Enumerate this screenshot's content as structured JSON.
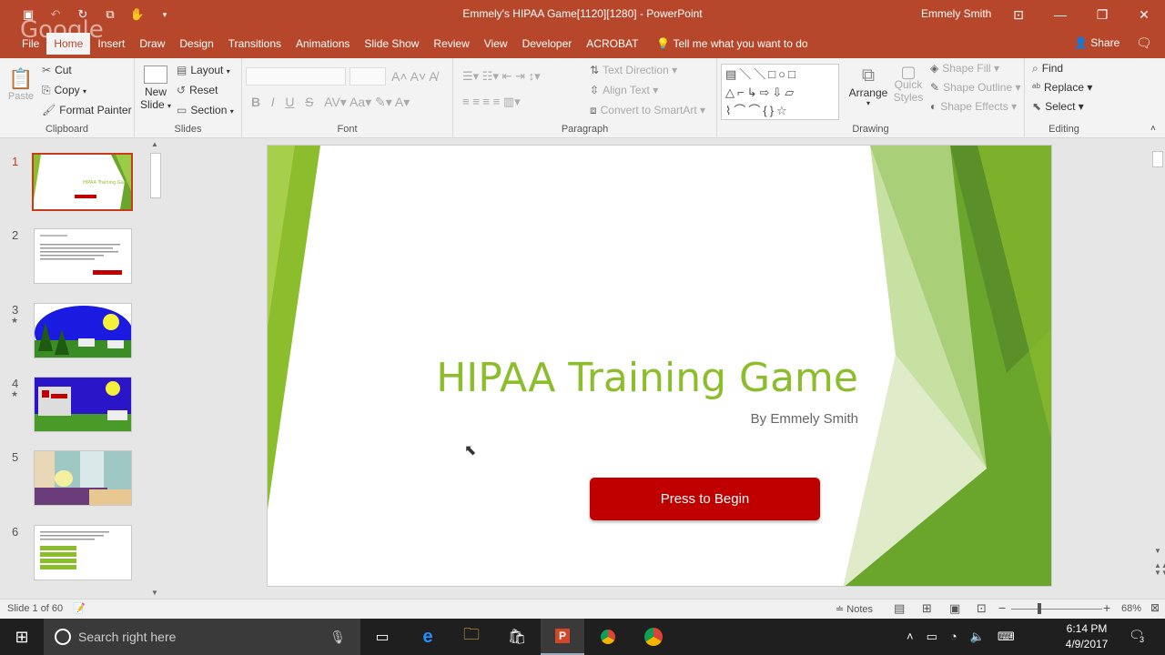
{
  "window": {
    "title": "Emmely's HIPAA Game[1120][1280]  -  PowerPoint",
    "user": "Emmely Smith",
    "overlay_logo": "Google"
  },
  "menu": {
    "tabs": [
      "File",
      "Home",
      "Insert",
      "Draw",
      "Design",
      "Transitions",
      "Animations",
      "Slide Show",
      "Review",
      "View",
      "Developer",
      "ACROBAT"
    ],
    "active_tab": "Home",
    "tell_me": "Tell me what you want to do",
    "share": "Share"
  },
  "ribbon": {
    "clipboard": {
      "paste": "Paste",
      "cut": "Cut",
      "copy": "Copy",
      "format_painter": "Format Painter",
      "label": "Clipboard"
    },
    "slides": {
      "new_slide_1": "New",
      "new_slide_2": "Slide",
      "layout": "Layout",
      "reset": "Reset",
      "section": "Section",
      "label": "Slides"
    },
    "font": {
      "label": "Font",
      "bold": "B",
      "italic": "I",
      "underline": "U",
      "strike": "S"
    },
    "paragraph": {
      "label": "Paragraph",
      "text_direction": "Text Direction",
      "align_text": "Align Text",
      "convert_smartart": "Convert to SmartArt"
    },
    "drawing": {
      "label": "Drawing",
      "arrange": "Arrange",
      "quick_styles_1": "Quick",
      "quick_styles_2": "Styles",
      "shape_fill": "Shape Fill",
      "shape_outline": "Shape Outline",
      "shape_effects": "Shape Effects"
    },
    "editing": {
      "label": "Editing",
      "find": "Find",
      "replace": "Replace",
      "select": "Select"
    }
  },
  "thumbnails": [
    {
      "num": "1",
      "animated": false,
      "title": "HIPAA Training Game"
    },
    {
      "num": "2",
      "animated": false
    },
    {
      "num": "3",
      "animated": true
    },
    {
      "num": "4",
      "animated": true
    },
    {
      "num": "5",
      "animated": false
    },
    {
      "num": "6",
      "animated": false
    }
  ],
  "slide": {
    "title": "HIPAA Training Game",
    "subtitle": "By Emmely Smith",
    "button": "Press to Begin"
  },
  "status": {
    "slide_info": "Slide 1 of 60",
    "notes": "Notes",
    "zoom": "68%"
  },
  "taskbar": {
    "search_placeholder": "Search right here",
    "time": "6:14 PM",
    "date": "4/9/2017",
    "notification_count": "3"
  },
  "colors": {
    "accent": "#b7472a",
    "slide_green": "#8cbd2c",
    "button_red": "#c00000"
  }
}
